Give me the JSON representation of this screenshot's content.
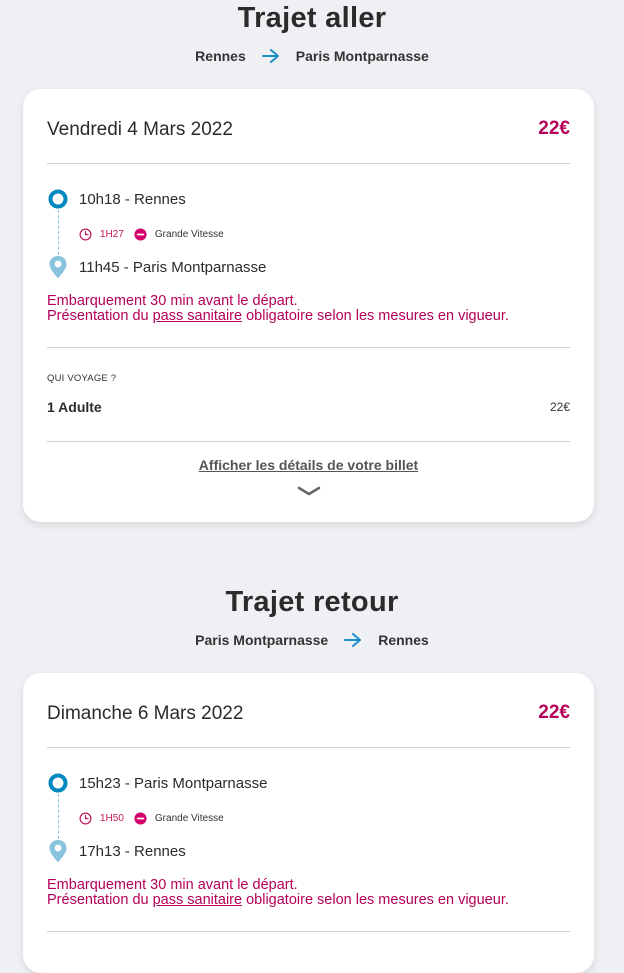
{
  "outbound": {
    "title": "Trajet aller",
    "origin": "Rennes",
    "destination": "Paris Montparnasse",
    "date": "Vendredi 4 Mars 2022",
    "price": "22€",
    "departure": "10h18 - Rennes",
    "duration": "1H27",
    "train_type": "Grande Vitesse",
    "arrival": "11h45 - Paris Montparnasse",
    "notice_line1": "Embarquement 30 min avant le départ.",
    "notice_prefix": "Présentation du ",
    "notice_link": "pass sanitaire",
    "notice_suffix": " obligatoire selon les mesures en vigueur.",
    "travelers_label": "QUI VOYAGE ?",
    "traveler": "1 Adulte",
    "traveler_price": "22€",
    "details_link": "Afficher les détails de votre billet"
  },
  "return": {
    "title": "Trajet retour",
    "origin": "Paris Montparnasse",
    "destination": "Rennes",
    "date": "Dimanche 6 Mars 2022",
    "price": "22€",
    "departure": "15h23 - Paris Montparnasse",
    "duration": "1H50",
    "train_type": "Grande Vitesse",
    "arrival": "17h13 - Rennes",
    "notice_line1": "Embarquement 30 min avant le départ.",
    "notice_prefix": "Présentation du ",
    "notice_link": "pass sanitaire",
    "notice_suffix": " obligatoire selon les mesures en vigueur."
  },
  "colors": {
    "accent": "#b5005a",
    "departure_marker": "#0088c1",
    "arrival_marker": "#8ac3dd",
    "route_arrow": "#1a8fc9",
    "background": "#eff0f3"
  },
  "icons": {
    "route_arrow": "arrow-right-icon",
    "departure": "circle-marker-icon",
    "arrival": "map-pin-icon",
    "duration": "clock-icon",
    "brand": "ouigo-logo-icon",
    "expand": "chevron-down-icon"
  }
}
